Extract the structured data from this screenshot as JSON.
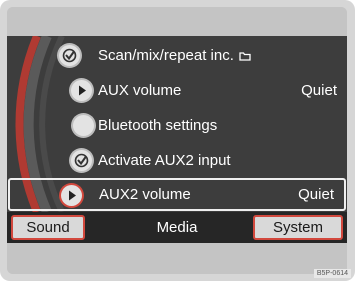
{
  "menu": {
    "items": [
      {
        "label": "Scan/mix/repeat inc.",
        "value": "",
        "icon": "checkbox-checked-icon",
        "trailing_icon": "folder-icon",
        "selected": false
      },
      {
        "label": "AUX volume",
        "value": "Quiet",
        "icon": "play-arrow-icon",
        "selected": false
      },
      {
        "label": "Bluetooth settings",
        "value": "",
        "icon": "blank-circle-icon",
        "selected": false
      },
      {
        "label": "Activate AUX2 input",
        "value": "",
        "icon": "checkbox-checked-icon",
        "selected": false
      },
      {
        "label": "AUX2 volume",
        "value": "Quiet",
        "icon": "play-arrow-icon",
        "selected": true
      }
    ]
  },
  "tabs": {
    "left": "Sound",
    "middle": "Media",
    "right": "System"
  },
  "image_code": "B5P-0614",
  "colors": {
    "content_bg": "#3d3d3d",
    "highlight_red": "#d2483d",
    "tabbar_bg": "#262626"
  }
}
